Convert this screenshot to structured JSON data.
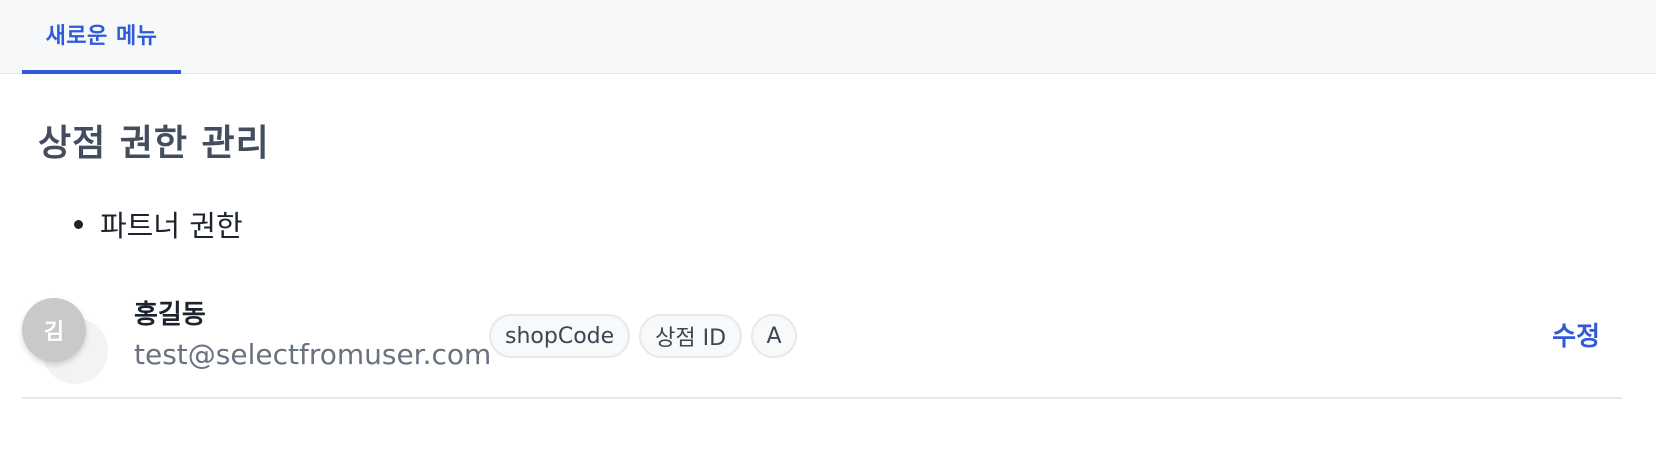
{
  "tabs": [
    {
      "label": "새로운 메뉴",
      "active": true
    }
  ],
  "page": {
    "title": "상점 권한 관리"
  },
  "permissions": {
    "items": [
      "파트너 권한"
    ]
  },
  "users": [
    {
      "avatar_initial": "김",
      "name": "홍길동",
      "email": "test@selectfromuser.com",
      "tags": [
        "shopCode",
        "상점 ID",
        "A"
      ],
      "edit_label": "수정"
    }
  ],
  "colors": {
    "accent": "#2f5bd8",
    "tab_bar_bg": "#f7f8fa",
    "avatar_bg": "#c9c9cb",
    "title_text": "#434d5e",
    "muted_text": "#697280"
  }
}
